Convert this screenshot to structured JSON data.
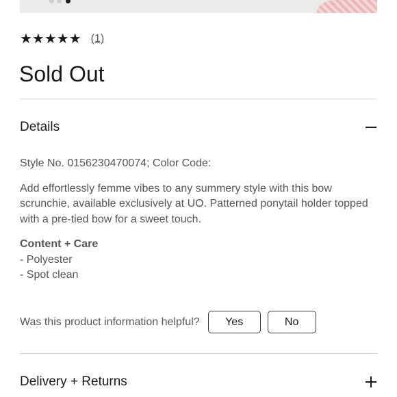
{
  "product": {
    "rating_stars": "★★★★★",
    "review_count": "(1)",
    "status": "Sold Out"
  },
  "details": {
    "title": "Details",
    "style_line": "Style No. 0156230470074; Color Code:",
    "description": "Add effortlessly femme vibes to any summery style with this bow scrunchie, available exclusively at UO. Patterned ponytail holder topped with a pre-tied bow for a sweet touch.",
    "care_title": "Content + Care",
    "care_items": [
      "- Polyester",
      "- Spot clean"
    ]
  },
  "feedback": {
    "question": "Was this product information helpful?",
    "yes_label": "Yes",
    "no_label": "No"
  },
  "delivery": {
    "title": "Delivery + Returns"
  }
}
